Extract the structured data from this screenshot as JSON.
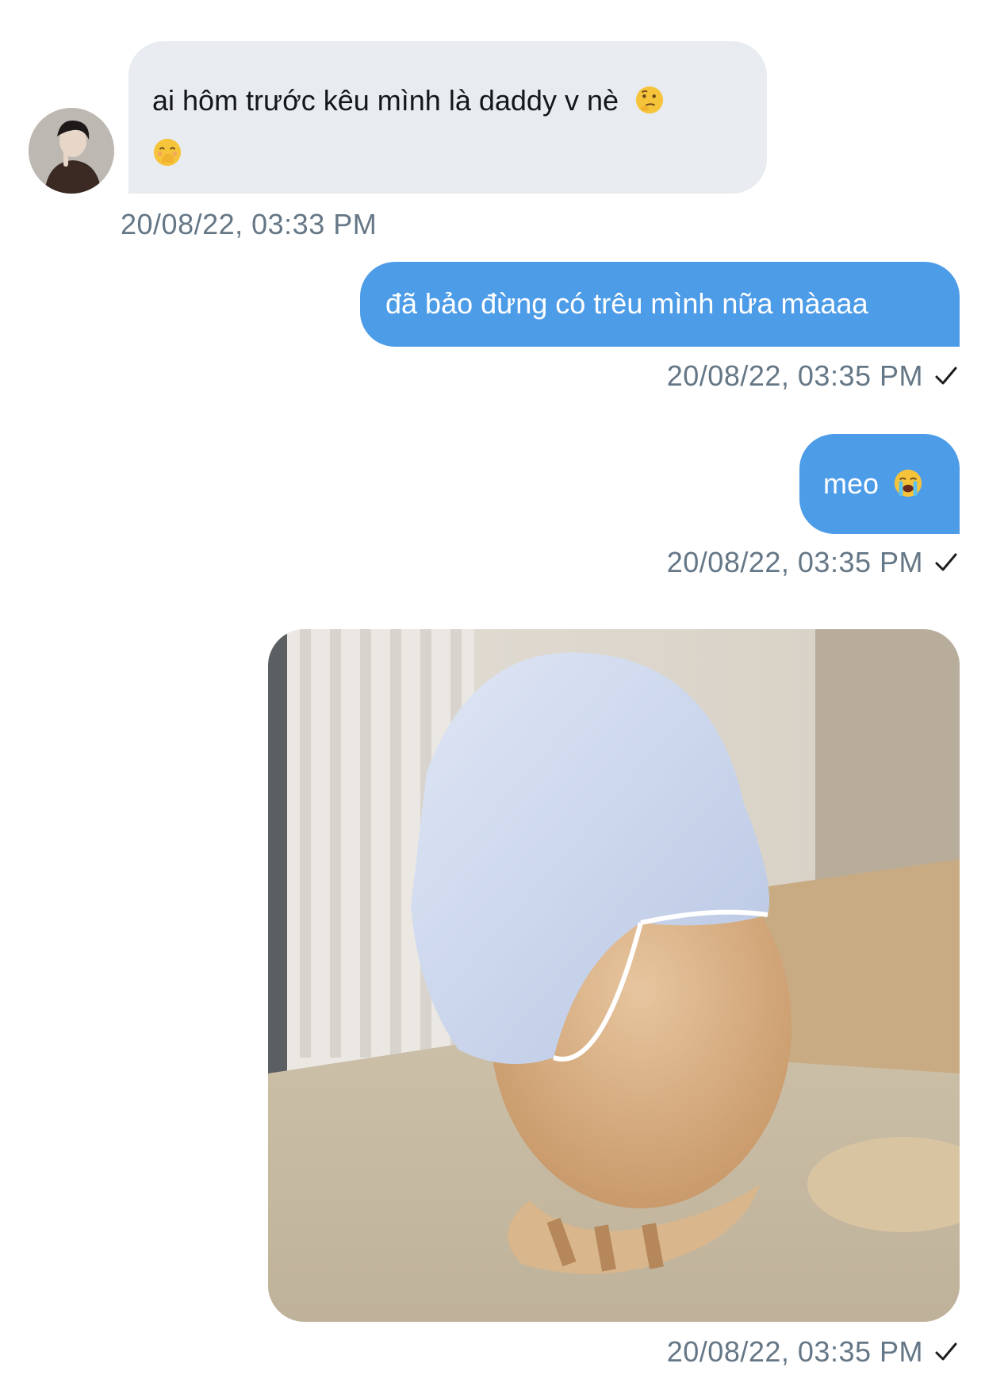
{
  "messages": [
    {
      "direction": "incoming",
      "text": "ai hôm trước kêu mình là daddy v nè",
      "emojis": [
        "thinking-face",
        "face-with-hand-over-mouth"
      ],
      "timestamp": "20/08/22, 03:33 PM"
    },
    {
      "direction": "outgoing",
      "text": "đã bảo đừng có trêu mình nữa màaaa",
      "timestamp": "20/08/22, 03:35 PM",
      "status": "sent"
    },
    {
      "direction": "outgoing",
      "text": "meo",
      "emojis": [
        "loudly-crying-face"
      ],
      "timestamp": "20/08/22, 03:35 PM",
      "status": "sent"
    },
    {
      "direction": "outgoing",
      "type": "image",
      "image_subject": "cat-with-cloth-on-head",
      "timestamp": "20/08/22, 03:35 PM",
      "status": "sent"
    }
  ],
  "colors": {
    "incoming_bubble": "#e8ebef",
    "outgoing_bubble": "#4d9ce8",
    "timestamp": "#657786"
  }
}
